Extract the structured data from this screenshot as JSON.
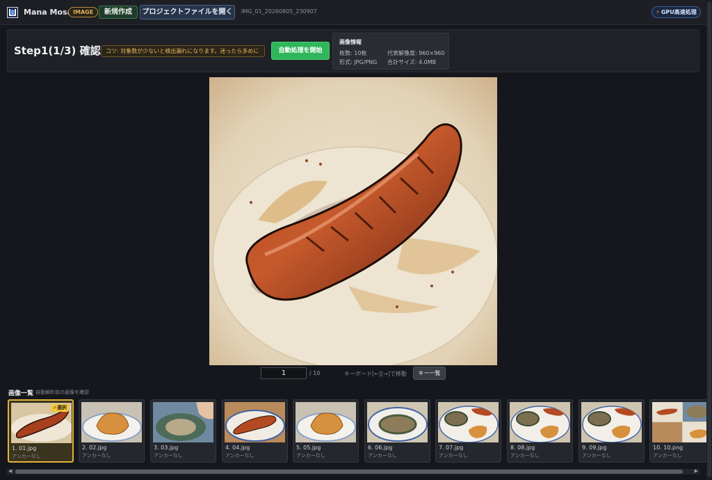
{
  "header": {
    "app_title": "Mana Mosaic",
    "mode_badge": "IMAGE",
    "new_button": "新規作成",
    "open_button": "プロジェクトファイルを開く",
    "project_name": "IMG_01_20260805_230907",
    "gpu_badge": "GPU高速処理"
  },
  "step": {
    "title": "Step1(1/3) 確認",
    "tip": "コツ: 対象数が少ないと検出漏れになります。迷ったら多めに",
    "auto_button": "自動処理を開始"
  },
  "image_info": {
    "heading": "画像情報",
    "count": "枚数: 10枚",
    "resolution": "代表解像度: 960×960",
    "format": "形式: JPG/PNG",
    "total_size": "合計サイズ: 4.0MB"
  },
  "pager": {
    "current_page": "1",
    "total": "/ 10",
    "keyboard_hint": "キーボード[←][→]で移動",
    "keys_button": "キー一覧"
  },
  "gallery": {
    "title": "画像一覧",
    "subtitle": "自動解析前の画像を確認",
    "selected_badge": "✓選択",
    "items": [
      {
        "filename": "1. 01.jpg",
        "anchor": "アンカーなし",
        "kind": "sausage"
      },
      {
        "filename": "2. 02.jpg",
        "anchor": "アンカーなし",
        "kind": "inari"
      },
      {
        "filename": "3. 03.jpg",
        "anchor": "アンカーなし",
        "kind": "abalone-hand"
      },
      {
        "filename": "4. 04.jpg",
        "anchor": "アンカーなし",
        "kind": "sausage-plate"
      },
      {
        "filename": "5. 05.jpg",
        "anchor": "アンカーなし",
        "kind": "inari"
      },
      {
        "filename": "6. 06.jpg",
        "anchor": "アンカーなし",
        "kind": "abalone"
      },
      {
        "filename": "7. 07.jpg",
        "anchor": "アンカーなし",
        "kind": "mixed"
      },
      {
        "filename": "8. 08.jpg",
        "anchor": "アンカーなし",
        "kind": "mixed"
      },
      {
        "filename": "9. 09.jpg",
        "anchor": "アンカーなし",
        "kind": "mixed"
      },
      {
        "filename": "10. 10.png",
        "anchor": "アンカーなし",
        "kind": "collage"
      }
    ]
  },
  "colors": {
    "accent_green": "#2fb65a",
    "selected_border": "#e2b23c",
    "tip_text": "#e6b963"
  }
}
